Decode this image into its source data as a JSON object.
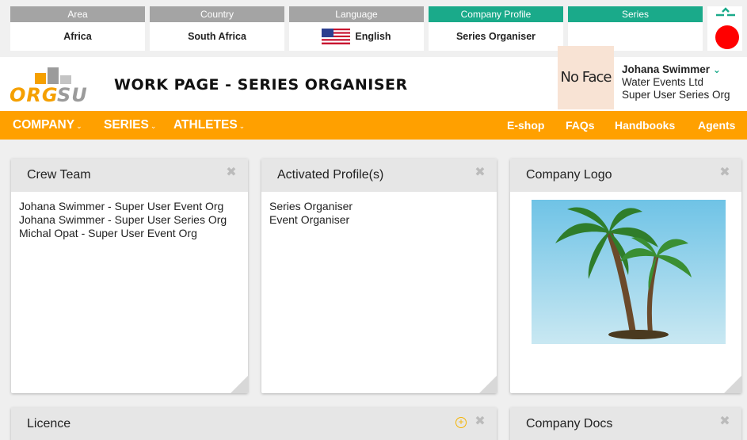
{
  "selectors": [
    {
      "label": "Area",
      "value": "Africa",
      "active": false
    },
    {
      "label": "Country",
      "value": "South Africa",
      "active": false
    },
    {
      "label": "Language",
      "value": "English",
      "active": false
    },
    {
      "label": "Company Profile",
      "value": "Series Organiser",
      "active": true
    },
    {
      "label": "Series",
      "value": "",
      "active": true
    }
  ],
  "header": {
    "logo_text": "ORGSU",
    "title": "WORK PAGE - SERIES ORGANISER",
    "avatar_placeholder": "No Face",
    "user": {
      "name": "Johana Swimmer",
      "company": "Water Events Ltd",
      "role": "Super User Series Org"
    }
  },
  "nav": {
    "left": [
      "COMPANY",
      "SERIES",
      "ATHLETES"
    ],
    "right": [
      "E-shop",
      "FAQs",
      "Handbooks",
      "Agents"
    ]
  },
  "panels": {
    "crew": {
      "title": "Crew Team",
      "items": [
        "Johana Swimmer - Super User Event Org",
        "Johana Swimmer - Super User Series Org",
        "Michal Opat - Super User Event Org"
      ]
    },
    "profiles": {
      "title": "Activated Profile(s)",
      "items": [
        "Series Organiser",
        "Event Organiser"
      ]
    },
    "logo": {
      "title": "Company Logo"
    },
    "licence": {
      "title": "Licence"
    },
    "docs": {
      "title": "Company Docs"
    }
  },
  "colors": {
    "accent_orange": "#ffa000",
    "accent_green": "#1aaa8a",
    "record_red": "#ff0000"
  }
}
